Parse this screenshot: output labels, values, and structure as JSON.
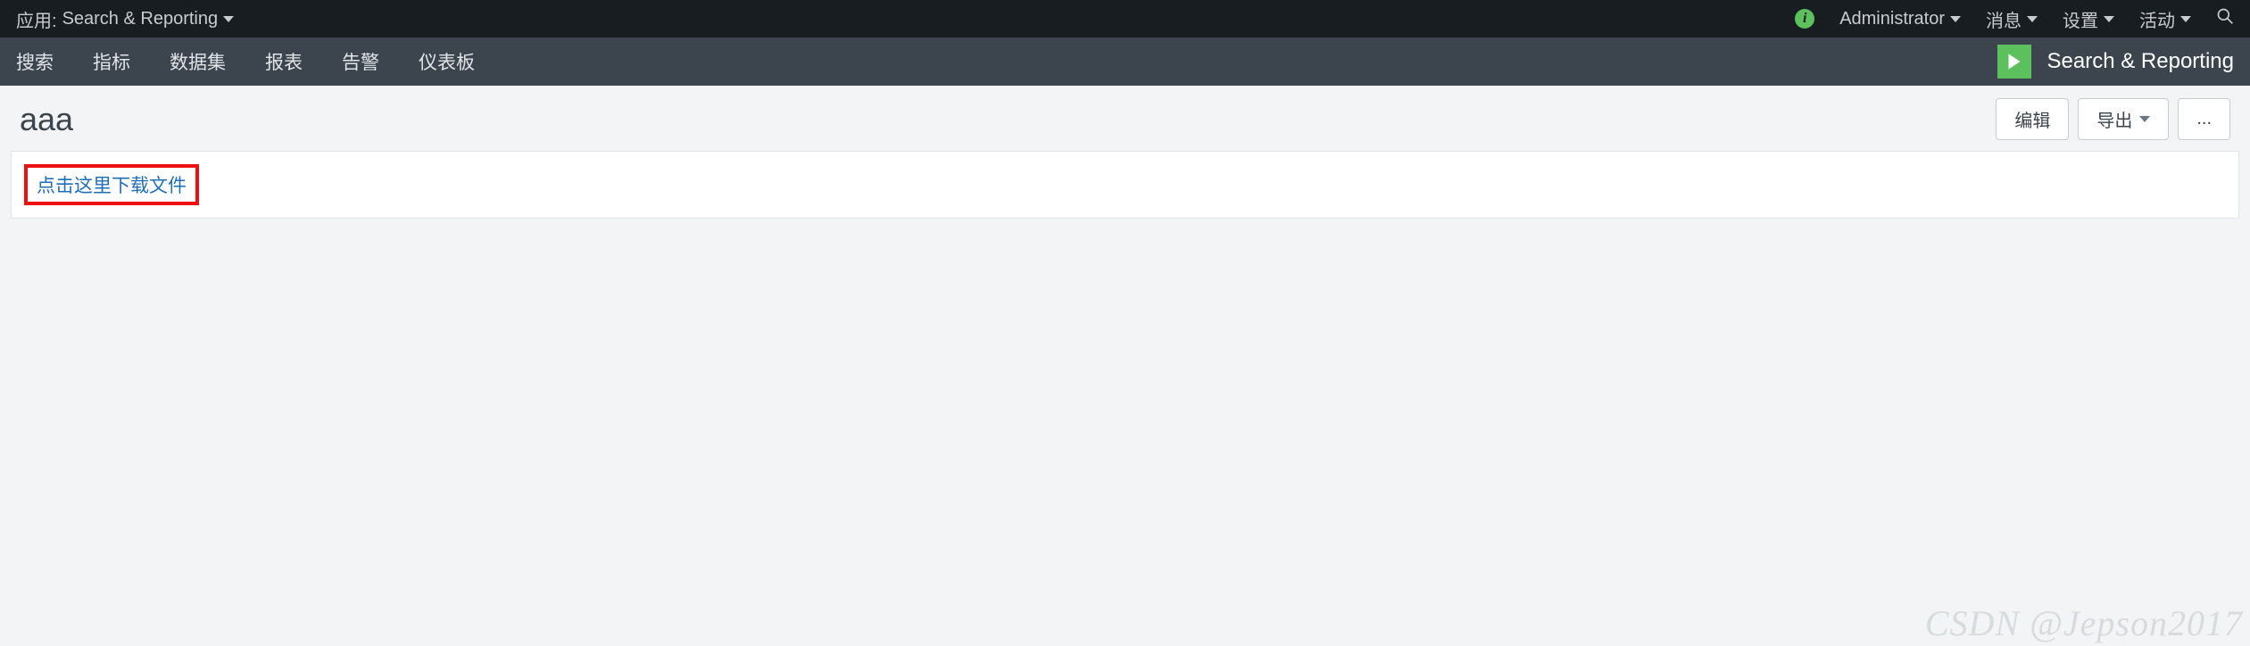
{
  "topbar": {
    "app_prefix": "应用:",
    "app_name": "Search & Reporting",
    "user_label": "Administrator",
    "messages_label": "消息",
    "settings_label": "设置",
    "activity_label": "活动"
  },
  "appnav": {
    "items": [
      "搜索",
      "指标",
      "数据集",
      "报表",
      "告警",
      "仪表板"
    ],
    "brand_label": "Search & Reporting"
  },
  "page": {
    "title": "aaa",
    "actions": {
      "edit_label": "编辑",
      "export_label": "导出",
      "more_label": "..."
    }
  },
  "panel": {
    "download_link_text": "点击这里下载文件"
  },
  "watermark": "CSDN @Jepson2017"
}
